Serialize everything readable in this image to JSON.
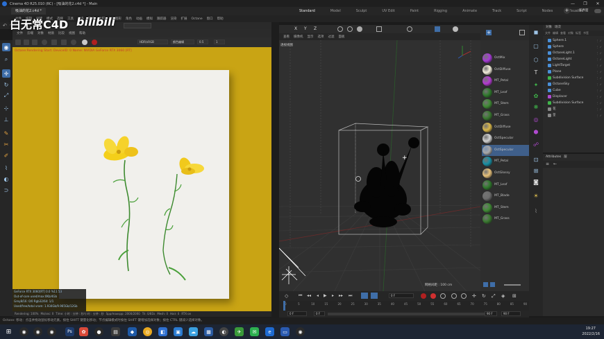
{
  "window": {
    "title": "Cinema 4D R25.010 (RC) - [吸油的花2.c4d *] - Main",
    "controls": [
      "—",
      "❐",
      "✕"
    ]
  },
  "doc_tab": {
    "label": "吸油的花2.c4d *"
  },
  "layout_tabs": [
    "Standard",
    "Model",
    "Sculpt",
    "UV Edit",
    "Paint",
    "Rigging",
    "Animate",
    "Track",
    "Script",
    "Nodes",
    "Visualize"
  ],
  "layout_active": "Standard",
  "new_layouts_label": "新界面",
  "main_menu": [
    "文件",
    "编辑",
    "创建",
    "模式",
    "选择",
    "工具",
    "样条",
    "网格",
    "体积",
    "运动图形",
    "角色",
    "动画",
    "模拟",
    "跟踪器",
    "渲染",
    "扩展",
    "Octane",
    "窗口",
    "帮助"
  ],
  "watermark": {
    "text": "白无常C4D",
    "brand": "bilibili"
  },
  "picture_viewer": {
    "menu": [
      "文件",
      "云端",
      "对象",
      "材质",
      "比较",
      "视图",
      "帮助"
    ],
    "mode_select": "HDR/sRGB",
    "tonemap_select": "颜色编辑",
    "value_a": "0.5",
    "value_b": "1",
    "render_log": "Octane:Rendering Start: DeviceID: 0 Name: NVIDIA GeForce RTX 3060 [RT]",
    "stats": [
      "GeForce RTX 3060[RT] 0.0  %11   53",
      "Out-of-core used/max:0Kb/4Gb",
      "Grey8/16: 0/0       Rgb32/64: 1/1",
      "Used/free/total vram: 1.934Gb/9.965Gb/12Gb"
    ],
    "status": {
      "rendering": "Rendering: 100%",
      "ms": "Ms/sec: 0",
      "time": "Time: 小时 : 分钟 : 秒/小时 : 分钟 : 秒",
      "spp": "Spp/maxspp: 2000/2000",
      "tri": "Tri: 0/81k",
      "mesh": "Mesh: 0",
      "hair": "Hair: 0",
      "rtx": "RTX:on"
    }
  },
  "viewport": {
    "menu": [
      "查看",
      "摄像机",
      "显示",
      "选项",
      "过滤",
      "面板"
    ],
    "label": "透视视图",
    "grid_label": "网格间距 : 100 cm"
  },
  "materials": [
    {
      "name": "OctMix",
      "color": "#a63bd6"
    },
    {
      "name": "OctDiffuse",
      "color": "#f3eedb"
    },
    {
      "name": "MT_Petal",
      "color": "#b43bd2"
    },
    {
      "name": "MT_Leaf",
      "color": "#2f7a2c"
    },
    {
      "name": "MT_Stem",
      "color": "#3f8a34"
    },
    {
      "name": "MT_Grass",
      "color": "#3a7a30"
    },
    {
      "name": "OctDiffuse",
      "color": "#d8b64a"
    },
    {
      "name": "OctSpecular",
      "color": "#d0d0d0"
    },
    {
      "name": "OctSpecular",
      "color": "#a8a8a8"
    },
    {
      "name": "MT_Petal",
      "color": "#178fa4"
    },
    {
      "name": "OctGlossy",
      "color": "#e6c07a"
    },
    {
      "name": "MT_Leaf",
      "color": "#2f7a2c"
    },
    {
      "name": "MT_Blade",
      "color": "#6d6d6d"
    },
    {
      "name": "MT_Stem",
      "color": "#3f8a34"
    },
    {
      "name": "MT_Grass",
      "color": "#3a7a30"
    }
  ],
  "selected_material_index": 8,
  "object_manager": {
    "tabs": [
      "对象",
      "场次"
    ],
    "menu": [
      "文件",
      "编辑",
      "查看",
      "对象",
      "标签",
      "书签"
    ],
    "items": [
      {
        "name": "Sphere.1",
        "color": "#4a90d9"
      },
      {
        "name": "Sphere",
        "color": "#4a90d9"
      },
      {
        "name": "OctaneLight.1",
        "color": "#4a90d9"
      },
      {
        "name": "OctaneLight",
        "color": "#4a90d9"
      },
      {
        "name": "LightTarget",
        "color": "#4a90d9"
      },
      {
        "name": "Plane",
        "color": "#4a90d9"
      },
      {
        "name": "Subdivision Surface",
        "color": "#3fb54a"
      },
      {
        "name": "OctaneSky",
        "color": "#4a90d9"
      },
      {
        "name": "Cube",
        "color": "#4a90d9"
      },
      {
        "name": "Displacer",
        "color": "#b04ad0"
      },
      {
        "name": "Subdivision Surface",
        "color": "#3fb54a"
      },
      {
        "name": "花",
        "color": "#888888"
      },
      {
        "name": "茎",
        "color": "#888888"
      }
    ]
  },
  "attributes": {
    "tabs": [
      "Attributes",
      "层"
    ],
    "nav": [
      "≡",
      "←"
    ]
  },
  "timeline": {
    "ticks": [
      "0",
      "5",
      "10",
      "15",
      "20",
      "25",
      "30",
      "35",
      "40",
      "45",
      "50",
      "55",
      "60",
      "65",
      "70",
      "75",
      "80",
      "85",
      "90"
    ],
    "current_frame": "0 F",
    "start": "0 F",
    "min": "0 F",
    "max": "90 F",
    "end": "90 F"
  },
  "statusbar": {
    "text": "Octane:   移动：点击并拖动鼠标移动元素。按住 SHIFT 键量化移动；节点编辑模式时按住 SHIFT 键增加选择对象；按住 CTRL 键减少选择对象。"
  },
  "taskbar": {
    "time": "19:27",
    "date": "2022/2/16"
  }
}
